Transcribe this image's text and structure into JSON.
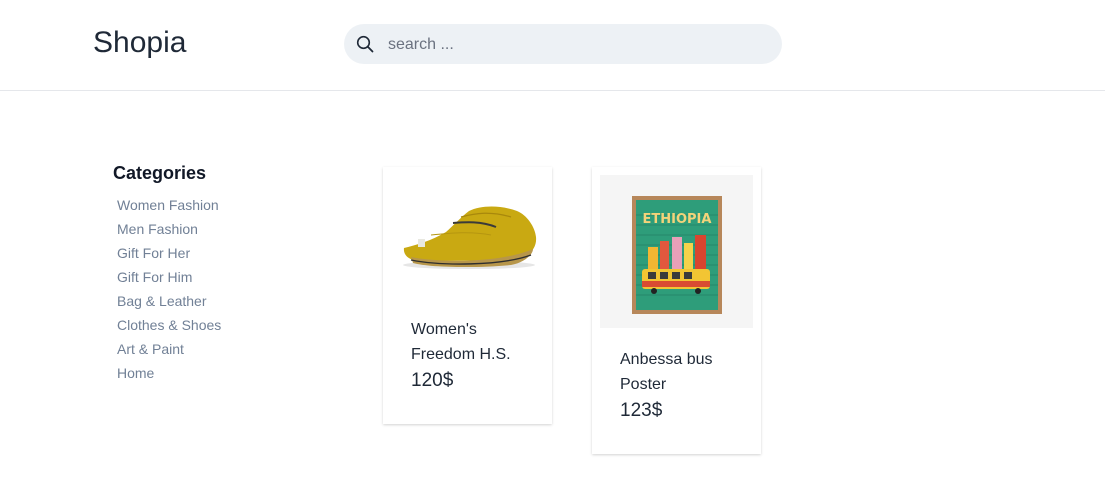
{
  "header": {
    "logo": "Shopia",
    "search": {
      "placeholder": "search ...",
      "value": ""
    }
  },
  "sidebar": {
    "title": "Categories",
    "items": [
      {
        "label": "Women Fashion"
      },
      {
        "label": "Men Fashion"
      },
      {
        "label": "Gift For Her"
      },
      {
        "label": "Gift For Him"
      },
      {
        "label": "Bag & Leather"
      },
      {
        "label": "Clothes & Shoes"
      },
      {
        "label": "Art & Paint"
      },
      {
        "label": "Home"
      }
    ]
  },
  "products": [
    {
      "name": "Women's Freedom H.S.",
      "price": "120$",
      "image": "yellow-slip-on-shoe"
    },
    {
      "name": "Anbessa bus Poster",
      "price": "123$",
      "image": "ethiopia-poster",
      "poster_text": "ETHIOPIA"
    }
  ]
}
